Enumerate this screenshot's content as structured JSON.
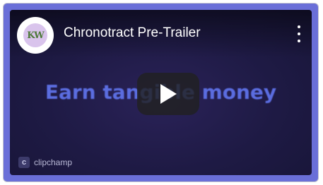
{
  "video": {
    "title": "Chronotract Pre-Trailer",
    "channel_avatar_text": "KW",
    "headline_text": "Earn tangible money",
    "brand_icon_text": "c",
    "brand_label": "clipchamp"
  },
  "colors": {
    "frame_border": "#6a6fd8",
    "background": "#1e1a44",
    "headline": "#5b6de0",
    "play_button": "#212121"
  },
  "icons": {
    "menu": "more-vert-icon",
    "play": "play-icon"
  }
}
